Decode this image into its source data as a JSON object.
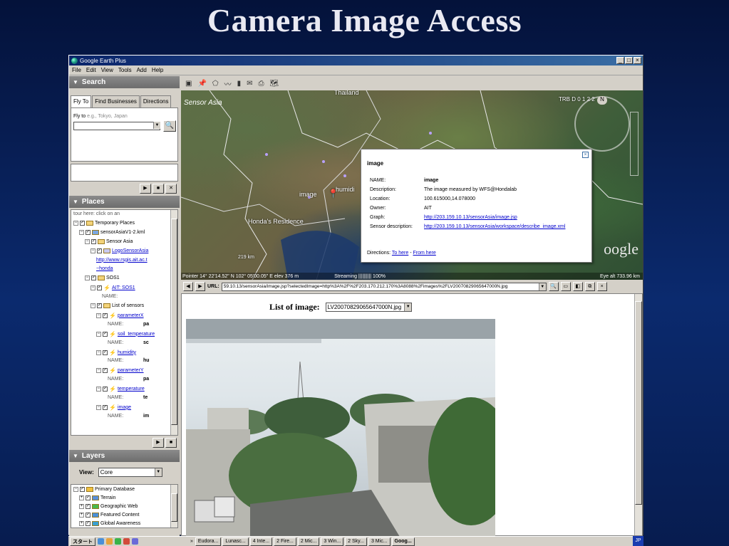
{
  "slide": {
    "title": "Camera Image Access"
  },
  "window": {
    "title": "Google Earth Plus",
    "controls": [
      "_",
      "□",
      "×"
    ]
  },
  "menu": [
    "File",
    "Edit",
    "View",
    "Tools",
    "Add",
    "Help"
  ],
  "search": {
    "header": "Search",
    "tabs": [
      "Fly To",
      "Find Businesses",
      "Directions"
    ],
    "flyto_label": "Fly to",
    "flyto_hint": "e.g., Tokyo, Japan",
    "flyto_value": ""
  },
  "places": {
    "header": "Places",
    "items": [
      {
        "text": "tour here: click on an",
        "indent": 0,
        "kind": "text"
      },
      {
        "text": "Temporary Places",
        "indent": 0,
        "kind": "folder"
      },
      {
        "text": "sensorAsiaV1-2.kml",
        "indent": 1,
        "kind": "kml"
      },
      {
        "text": "Sensor Asia",
        "indent": 2,
        "kind": "folder"
      },
      {
        "text": "LogoSensorAsia",
        "indent": 3,
        "kind": "link"
      },
      {
        "text": "http://www.rsgis.ait.ac.t",
        "indent": 4,
        "kind": "linktext"
      },
      {
        "text": "~honda",
        "indent": 4,
        "kind": "linktext"
      },
      {
        "text": "SOS1",
        "indent": 2,
        "kind": "folder"
      },
      {
        "text": "AIT: SOS1",
        "indent": 3,
        "kind": "pinlink"
      },
      {
        "text": "NAME:",
        "indent": 5,
        "kind": "label"
      },
      {
        "text": "List of sensors",
        "indent": 3,
        "kind": "folder"
      },
      {
        "text": "parameterX",
        "indent": 4,
        "kind": "pinlink"
      },
      {
        "text": "NAME:",
        "indent": 6,
        "kind": "label",
        "side": "pa"
      },
      {
        "text": "soil_temperature",
        "indent": 4,
        "kind": "pinlink"
      },
      {
        "text": "NAME:",
        "indent": 6,
        "kind": "label",
        "side": "sc"
      },
      {
        "text": "humidity",
        "indent": 4,
        "kind": "pinlink"
      },
      {
        "text": "NAME:",
        "indent": 6,
        "kind": "label",
        "side": "hu"
      },
      {
        "text": "parameterY",
        "indent": 4,
        "kind": "pinlink"
      },
      {
        "text": "NAME:",
        "indent": 6,
        "kind": "label",
        "side": "pa"
      },
      {
        "text": "temperature",
        "indent": 4,
        "kind": "pinlink"
      },
      {
        "text": "NAME:",
        "indent": 6,
        "kind": "label",
        "side": "te"
      },
      {
        "text": "image",
        "indent": 4,
        "kind": "pinlink"
      },
      {
        "text": "NAME:",
        "indent": 6,
        "kind": "label",
        "side": "im"
      }
    ]
  },
  "layers": {
    "header": "Layers",
    "view_label": "View:",
    "view_value": "Core",
    "items": [
      "Primary Database",
      "Terrain",
      "Geographic Web",
      "Featured Content",
      "Global Awareness"
    ]
  },
  "map": {
    "brand_label": "Sensor Asia",
    "labels": {
      "thailand": "Thailand",
      "image": "image",
      "humidity": "humidi",
      "residence": "Honda's Residence",
      "scale": "219 km",
      "top_right": "TRB D 0 1 2 2"
    },
    "watermark": "oogle",
    "compass_n": "N",
    "status": {
      "pointer": "Pointer 14° 22'14.52\" N 102° 05'00.05\" E elev 376 m",
      "streaming": "Streaming |||||||||| 100%",
      "eye": "Eye alt 733.96 km"
    }
  },
  "popup": {
    "title": "image",
    "rows": [
      {
        "k": "NAME:",
        "v": "image",
        "bold": true
      },
      {
        "k": "Description:",
        "v": "The image measured by WFS@Hondalab"
      },
      {
        "k": "Location:",
        "v": "100.615000,14.078000"
      },
      {
        "k": "Owner:",
        "v": "AIT"
      },
      {
        "k": "Graph:",
        "v": "http://203.159.10.13/sensorAsia/image.jsp",
        "link": true
      },
      {
        "k": "Sensor description:",
        "v": "http://203.159.10.13/sensorAsia/workspace/describe_image.xml",
        "link": true
      }
    ],
    "directions_label": "Directions:",
    "to_here": "To here",
    "from_here": "From here"
  },
  "browser": {
    "url_label": "URL:",
    "url": "59.10.13/sensorAsia/image.jsp?selectedImage=http%3A%2F%2F203.170.212.170%3A8088%2Fimages%2FLV20070829065647000N.jpg",
    "list_label": "List of image:",
    "list_value": "LV20070829065647000N.jpg"
  },
  "taskbar": {
    "start": "スタート",
    "tasks": [
      "Eudora...",
      "Lunasc...",
      "4 Inte...",
      "2 Fire...",
      "2 Mic...",
      "3 Win...",
      "2 Sky...",
      "3 Mic...",
      "Goog..."
    ],
    "lang": "JP"
  },
  "colors": {
    "title_bar": "#0a246a",
    "link": "#0000cc",
    "panel_head": "#7a7a7a"
  }
}
